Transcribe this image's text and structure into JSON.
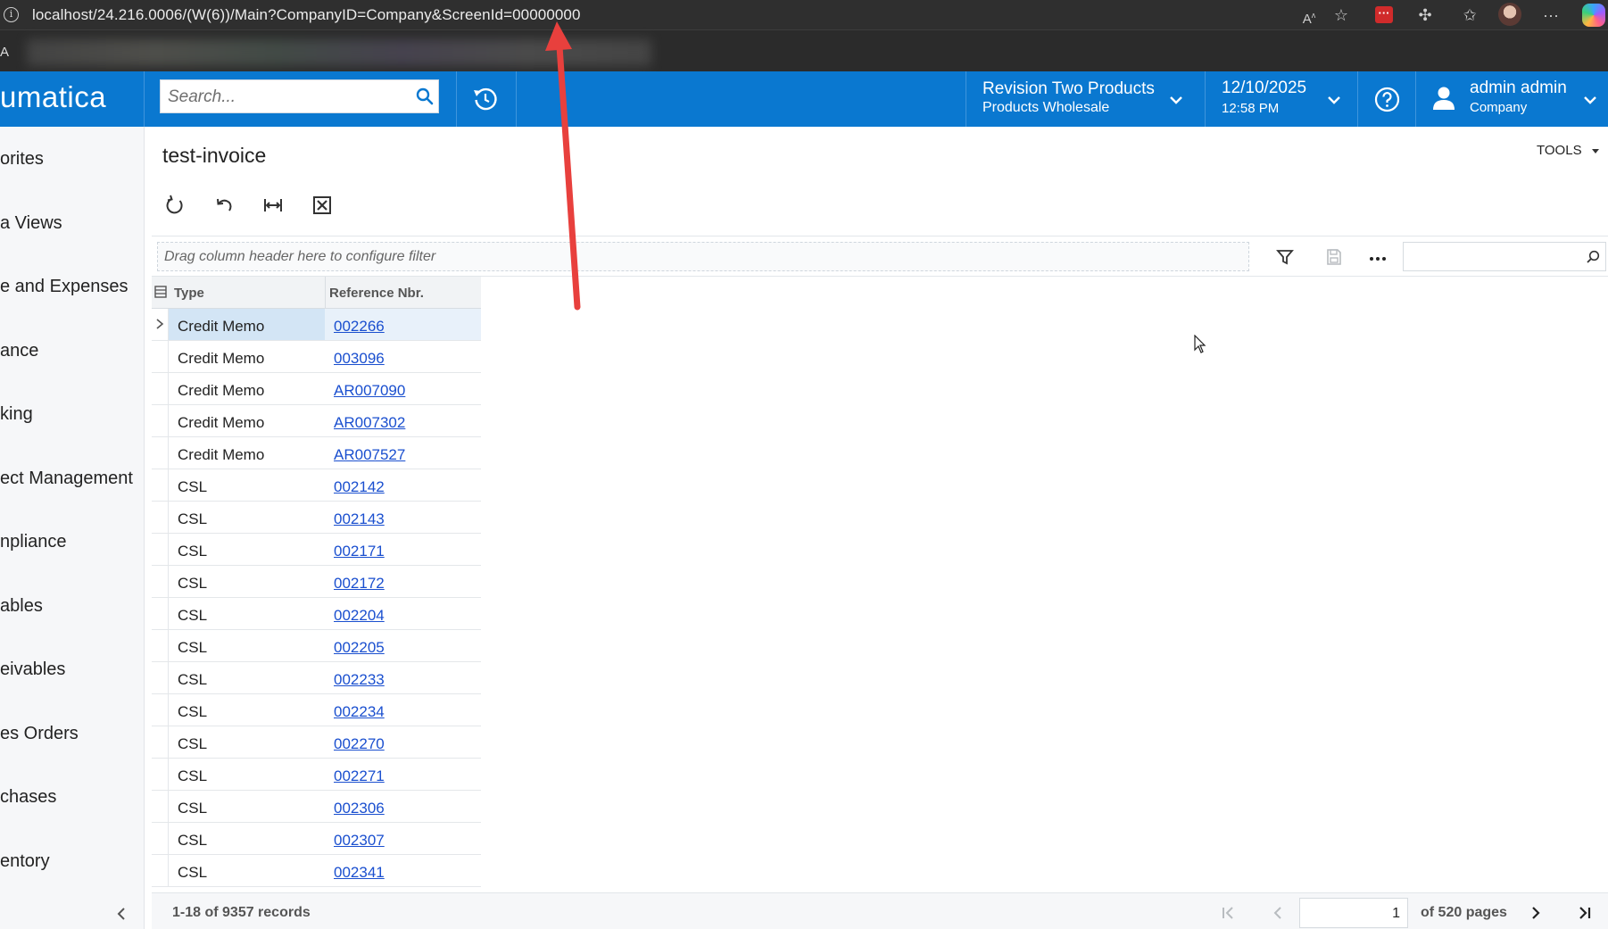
{
  "browser": {
    "url": "localhost/24.216.0006/(W(6))/Main?CompanyID=Company&ScreenId=00000000",
    "favorites_letter": "A"
  },
  "header": {
    "logo": "umatica",
    "search_placeholder": "Search...",
    "company_name": "Revision Two Products",
    "company_branch": "Products Wholesale",
    "date": "12/10/2025",
    "time": "12:58 PM",
    "user_name": "admin admin",
    "user_company": "Company"
  },
  "sidebar": {
    "items": [
      {
        "label": "orites"
      },
      {
        "label": "a Views"
      },
      {
        "label": "e and Expenses"
      },
      {
        "label": "ance"
      },
      {
        "label": "king"
      },
      {
        "label": "ect Management"
      },
      {
        "label": "npliance"
      },
      {
        "label": "ables"
      },
      {
        "label": "eivables"
      },
      {
        "label": "es Orders"
      },
      {
        "label": "chases"
      },
      {
        "label": "entory"
      }
    ]
  },
  "page": {
    "title": "test-invoice",
    "tools_label": "TOOLS",
    "filter_placeholder": "Drag column header here to configure filter"
  },
  "grid": {
    "columns": [
      "Type",
      "Reference Nbr."
    ],
    "rows": [
      {
        "type": "Credit Memo",
        "ref": "002266"
      },
      {
        "type": "Credit Memo",
        "ref": "003096"
      },
      {
        "type": "Credit Memo",
        "ref": "AR007090"
      },
      {
        "type": "Credit Memo",
        "ref": "AR007302"
      },
      {
        "type": "Credit Memo",
        "ref": "AR007527"
      },
      {
        "type": "CSL",
        "ref": "002142"
      },
      {
        "type": "CSL",
        "ref": "002143"
      },
      {
        "type": "CSL",
        "ref": "002171"
      },
      {
        "type": "CSL",
        "ref": "002172"
      },
      {
        "type": "CSL",
        "ref": "002204"
      },
      {
        "type": "CSL",
        "ref": "002205"
      },
      {
        "type": "CSL",
        "ref": "002233"
      },
      {
        "type": "CSL",
        "ref": "002234"
      },
      {
        "type": "CSL",
        "ref": "002270"
      },
      {
        "type": "CSL",
        "ref": "002271"
      },
      {
        "type": "CSL",
        "ref": "002306"
      },
      {
        "type": "CSL",
        "ref": "002307"
      },
      {
        "type": "CSL",
        "ref": "002341"
      }
    ]
  },
  "footer": {
    "records": "1-18 of 9357 records",
    "page": "1",
    "of_pages": "of 520 pages"
  },
  "colors": {
    "header_blue": "#0a78d0",
    "link_blue": "#1a4fcf",
    "annotation_red": "#e8403d"
  }
}
